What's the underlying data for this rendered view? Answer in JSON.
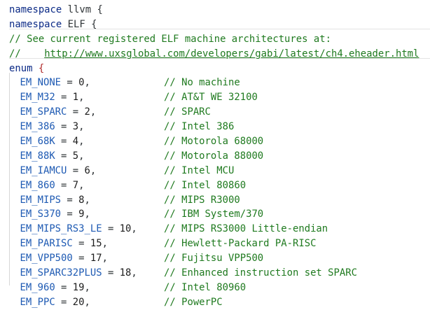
{
  "header": {
    "ns1": {
      "keyword": "namespace",
      "name": "llvm",
      "brace": "{"
    },
    "ns2": {
      "keyword": "namespace",
      "name": "ELF",
      "brace": "{"
    }
  },
  "comments": {
    "line1": "// See current registered ELF machine architectures at:",
    "line2_prefix": "//    ",
    "line2_url": "http://www.uxsglobal.com/developers/gabi/latest/ch4.eheader.html"
  },
  "enum_decl": {
    "keyword": "enum",
    "brace": "{"
  },
  "entries": [
    {
      "id": "EM_NONE",
      "value": "0",
      "comment": "// No machine"
    },
    {
      "id": "EM_M32",
      "value": "1",
      "comment": "// AT&T WE 32100"
    },
    {
      "id": "EM_SPARC",
      "value": "2",
      "comment": "// SPARC"
    },
    {
      "id": "EM_386",
      "value": "3",
      "comment": "// Intel 386"
    },
    {
      "id": "EM_68K",
      "value": "4",
      "comment": "// Motorola 68000"
    },
    {
      "id": "EM_88K",
      "value": "5",
      "comment": "// Motorola 88000"
    },
    {
      "id": "EM_IAMCU",
      "value": "6",
      "comment": "// Intel MCU"
    },
    {
      "id": "EM_860",
      "value": "7",
      "comment": "// Intel 80860"
    },
    {
      "id": "EM_MIPS",
      "value": "8",
      "comment": "// MIPS R3000"
    },
    {
      "id": "EM_S370",
      "value": "9",
      "comment": "// IBM System/370"
    },
    {
      "id": "EM_MIPS_RS3_LE",
      "value": "10",
      "comment": "// MIPS RS3000 Little-endian"
    },
    {
      "id": "EM_PARISC",
      "value": "15",
      "comment": "// Hewlett-Packard PA-RISC"
    },
    {
      "id": "EM_VPP500",
      "value": "17",
      "comment": "// Fujitsu VPP500"
    },
    {
      "id": "EM_SPARC32PLUS",
      "value": "18",
      "comment": "// Enhanced instruction set SPARC"
    },
    {
      "id": "EM_960",
      "value": "19",
      "comment": "// Intel 80960"
    },
    {
      "id": "EM_PPC",
      "value": "20",
      "comment": "// PowerPC"
    }
  ],
  "colors": {
    "keyword": "#0b2a86",
    "comment": "#1f7a1f",
    "enum_id": "#1e5ab3",
    "text": "#2f3437",
    "enum_brace": "#b02a2a"
  }
}
